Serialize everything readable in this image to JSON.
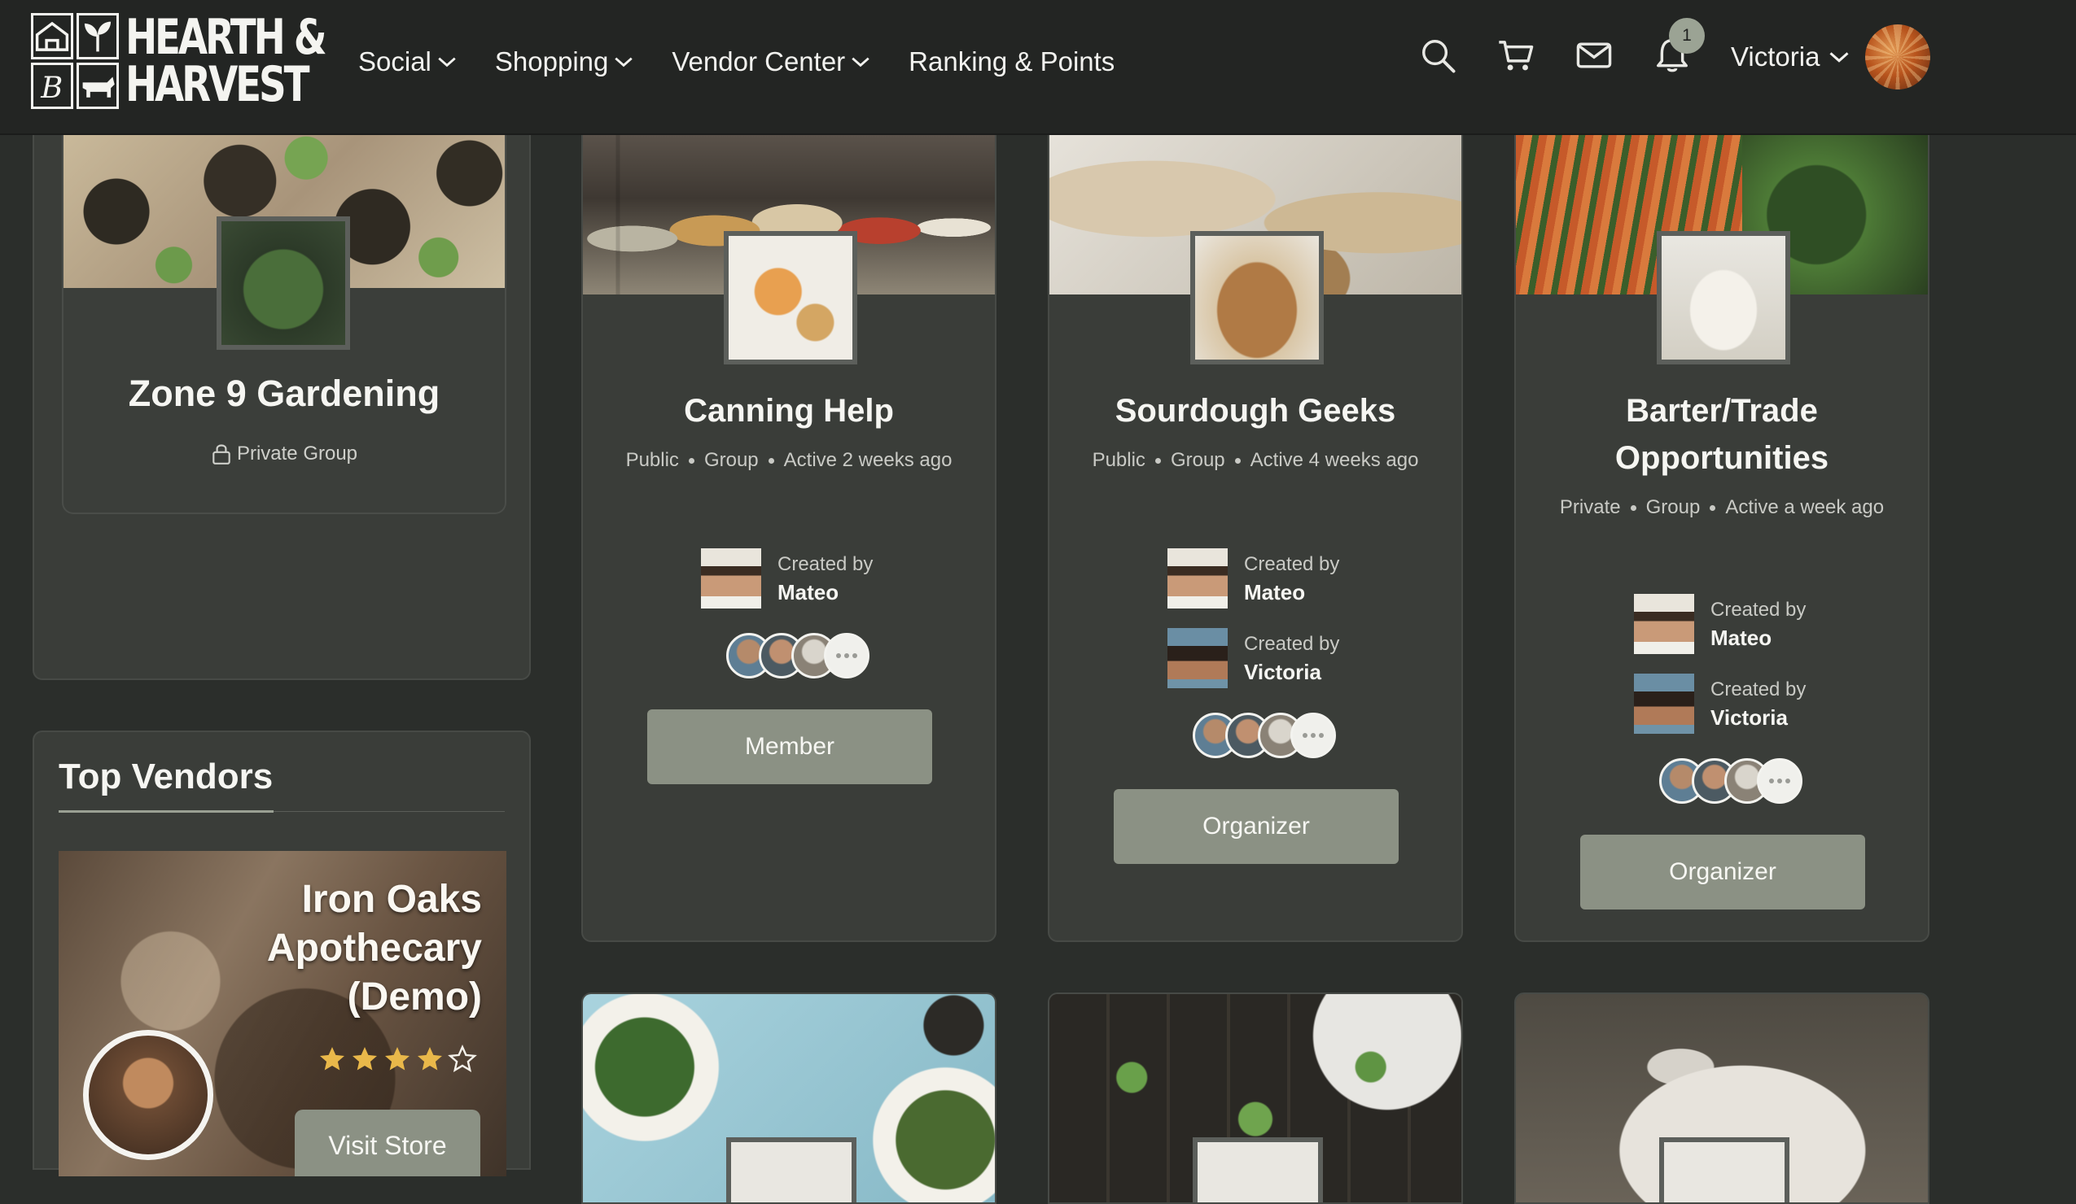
{
  "brand": {
    "line1": "HEARTH &",
    "line2": "HARVEST"
  },
  "nav": [
    {
      "label": "Social",
      "dropdown": true
    },
    {
      "label": "Shopping",
      "dropdown": true
    },
    {
      "label": "Vendor Center",
      "dropdown": true
    },
    {
      "label": "Ranking & Points",
      "dropdown": false
    }
  ],
  "header": {
    "icons": [
      "search-icon",
      "cart-icon",
      "mail-icon",
      "bell-icon"
    ],
    "notification_count": "1",
    "user_name": "Victoria"
  },
  "sidebar": {
    "group": {
      "title": "Zone 9 Gardening",
      "privacy": "Private Group"
    },
    "top_vendors": {
      "title": "Top Vendors",
      "vendor": {
        "name_lines": [
          "Iron Oaks",
          "Apothecary",
          "(Demo)"
        ],
        "rating": 4,
        "rating_max": 5,
        "button": "Visit Store"
      }
    }
  },
  "groups": [
    {
      "title": "Canning Help",
      "meta": [
        "Public",
        "Group",
        "Active 2 weeks ago"
      ],
      "creators": [
        {
          "label": "Created by",
          "name": "Mateo"
        }
      ],
      "button": "Member"
    },
    {
      "title": "Sourdough Geeks",
      "meta": [
        "Public",
        "Group",
        "Active 4 weeks ago"
      ],
      "creators": [
        {
          "label": "Created by",
          "name": "Mateo"
        },
        {
          "label": "Created by",
          "name": "Victoria"
        }
      ],
      "button": "Organizer"
    },
    {
      "title": "Barter/Trade Opportunities",
      "meta": [
        "Private",
        "Group",
        "Active a week ago"
      ],
      "creators": [
        {
          "label": "Created by",
          "name": "Mateo"
        },
        {
          "label": "Created by",
          "name": "Victoria"
        }
      ],
      "button": "Organizer"
    }
  ],
  "colors": {
    "background": "#2b2e2b",
    "header": "#232523",
    "card": "#3a3d39",
    "button": "#8b9184",
    "star": "#e9b84a"
  }
}
